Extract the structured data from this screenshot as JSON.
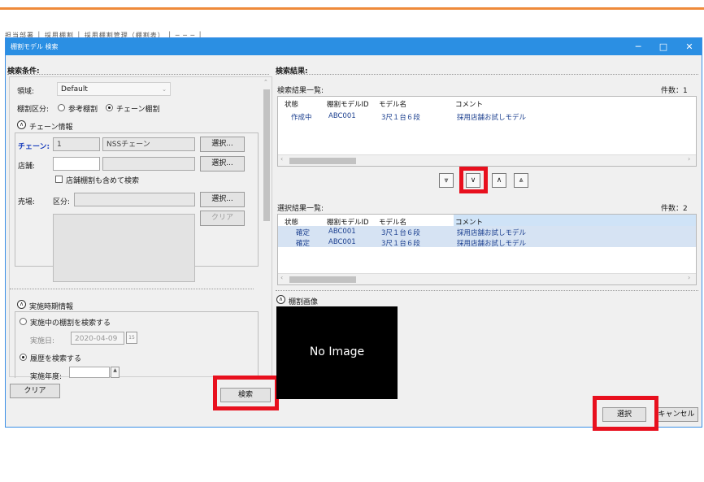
{
  "background_toolbar_text": "担当部署  │  採用棚割  │  採用棚割管理（棚割表）  │  ─  ─  ─  │",
  "window": {
    "title": "棚割モデル 検索",
    "minimize": "─",
    "maximize": "□",
    "close": "✕"
  },
  "left": {
    "header": "検索条件:",
    "region_label": "領域:",
    "region_value": "Default",
    "category_label": "棚割区分:",
    "radio_reference": "参考棚割",
    "radio_chain": "チェーン棚割",
    "chain_section": "チェーン情報",
    "chain_label": "チェーン:",
    "chain_code": "1",
    "chain_name": "NSSチェーン",
    "select_btn": "選択...",
    "store_label": "店舗:",
    "store_checkbox": "店舗棚割も含めて検索",
    "sales_label": "売場:",
    "division_label": "区分:",
    "clear_small": "クリア",
    "period_section": "実施時期情報",
    "radio_current": "実施中の棚割を検索する",
    "date_label": "実施日:",
    "date_value": "2020-04-09",
    "calendar_day": "15",
    "radio_history": "履歴を検索する",
    "year_label": "実施年度:",
    "clear_btn": "クリア",
    "search_btn": "検索"
  },
  "right": {
    "header": "検索結果:",
    "results_title": "検索結果一覧:",
    "results_count": "件数：1",
    "columns": [
      "状態",
      "棚割モデルID",
      "モデル名",
      "コメント"
    ],
    "results_rows": [
      [
        "作成中",
        "ABC001",
        "3尺１台６段",
        "採用店舗お試しモデル"
      ]
    ],
    "nav_buttons": [
      "⩔",
      "∨",
      "∧",
      "⩓"
    ],
    "selected_title": "選択結果一覧:",
    "selected_count": "件数：2",
    "selected_rows": [
      [
        "確定",
        "ABC001",
        "3尺１台６段",
        "採用店舗お試しモデル"
      ],
      [
        "確定",
        "ABC001",
        "3尺１台６段",
        "採用店舗お試しモデル"
      ]
    ],
    "image_section": "棚割画像",
    "no_image": "No Image",
    "select_btn": "選択",
    "cancel_btn": "キャンセル"
  },
  "colors": {
    "titlebar": "#2b8fe3",
    "highlight": "#e8101e",
    "selected_row": "#d6e3f3",
    "accent_line": "#ef8a3a"
  }
}
